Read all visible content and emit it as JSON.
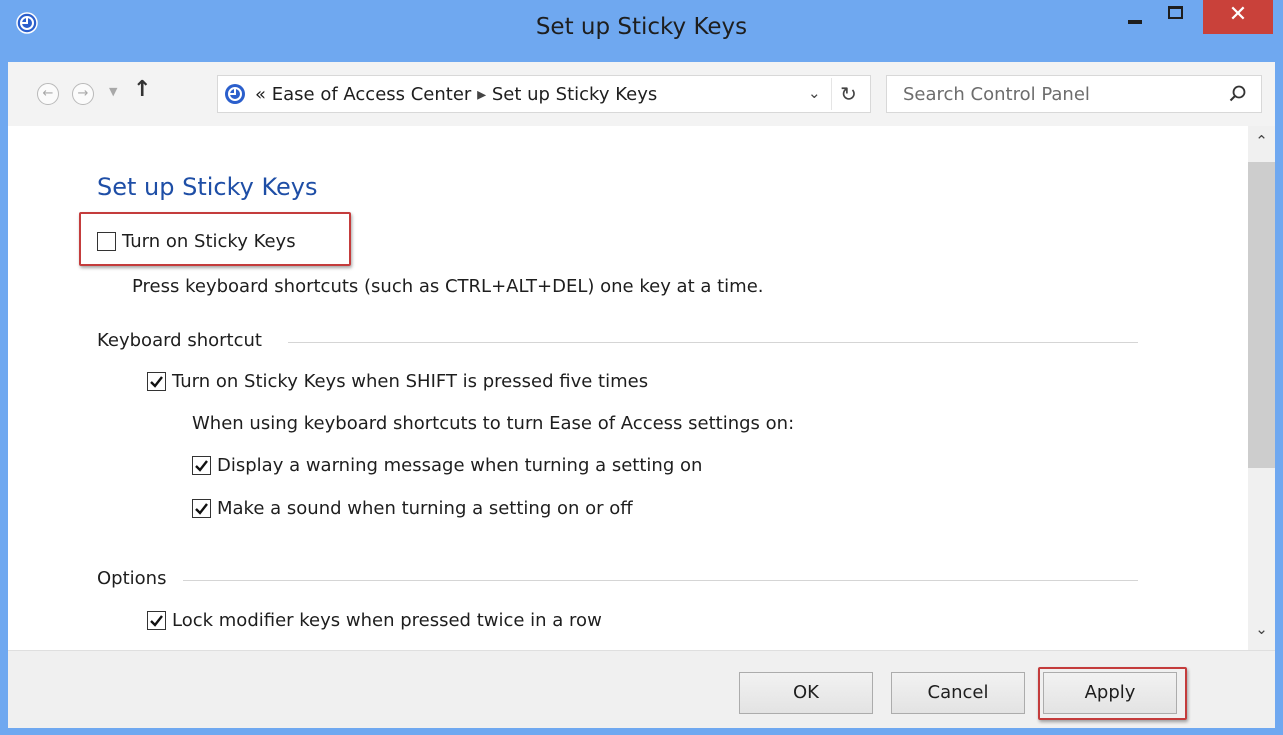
{
  "window": {
    "title": "Set up Sticky Keys",
    "close_glyph": "✕"
  },
  "nav": {
    "back_icon": "back-arrow-icon",
    "forward_icon": "forward-arrow-icon",
    "up_glyph": "↑",
    "breadcrumb": {
      "overflow": "«",
      "items": [
        "Ease of Access Center",
        "Set up Sticky Keys"
      ],
      "separator": "▸"
    },
    "dropdown_glyph": "⌄",
    "refresh_glyph": "↻",
    "search_placeholder": "Search Control Panel"
  },
  "content": {
    "page_title": "Set up Sticky Keys",
    "turn_on": {
      "label": "Turn on Sticky Keys",
      "checked": false
    },
    "turn_on_description": "Press keyboard shortcuts (such as CTRL+ALT+DEL) one key at a time.",
    "keyboard_shortcut": {
      "heading": "Keyboard shortcut",
      "shift_five": {
        "label": "Turn on Sticky Keys when SHIFT is pressed five times",
        "checked": true
      },
      "intro": "When using keyboard shortcuts to turn Ease of Access settings on:",
      "warning": {
        "label": "Display a warning message when turning a setting on",
        "checked": true
      },
      "sound": {
        "label": "Make a sound when turning a setting on or off",
        "checked": true
      }
    },
    "options": {
      "heading": "Options",
      "lock_modifier": {
        "label": "Lock modifier keys when pressed twice in a row",
        "checked": true
      }
    }
  },
  "scrollbar": {
    "up_glyph": "⌃",
    "down_glyph": "⌄"
  },
  "footer": {
    "ok_label": "OK",
    "cancel_label": "Cancel",
    "apply_label": "Apply"
  },
  "colors": {
    "titlebar": "#6fa8f0",
    "close_button": "#c9413a",
    "highlight": "#c43c3c",
    "page_title": "#1e4ea6"
  }
}
